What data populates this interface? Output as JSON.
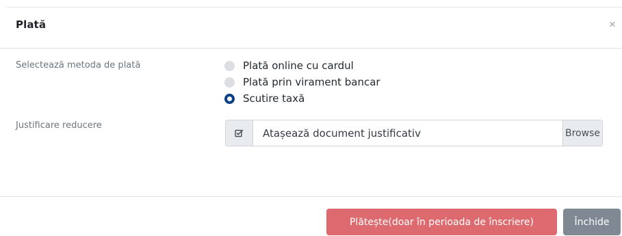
{
  "modal": {
    "title": "Plată",
    "close_glyph": "×",
    "close_icon": "close-icon"
  },
  "payment_method": {
    "label": "Selectează metoda de plată",
    "selected_index": 2,
    "options": [
      {
        "label": "Plată online cu cardul",
        "checked": false
      },
      {
        "label": "Plată prin virament bancar",
        "checked": false
      },
      {
        "label": "Scutire taxă",
        "checked": true
      }
    ]
  },
  "justification": {
    "label": "Justificare reducere",
    "icon": "checkbox-edit-icon",
    "placeholder": "Atașează document justificativ",
    "browse_label": "Browse"
  },
  "footer": {
    "pay_label": "Plătește(doar în perioada de înscriere)",
    "close_label": "Închide"
  },
  "colors": {
    "radio_selected": "#0a3e86",
    "radio_unselected": "#dcdee3",
    "pay_button": "#dc6a6f",
    "close_button": "#7f8893"
  }
}
